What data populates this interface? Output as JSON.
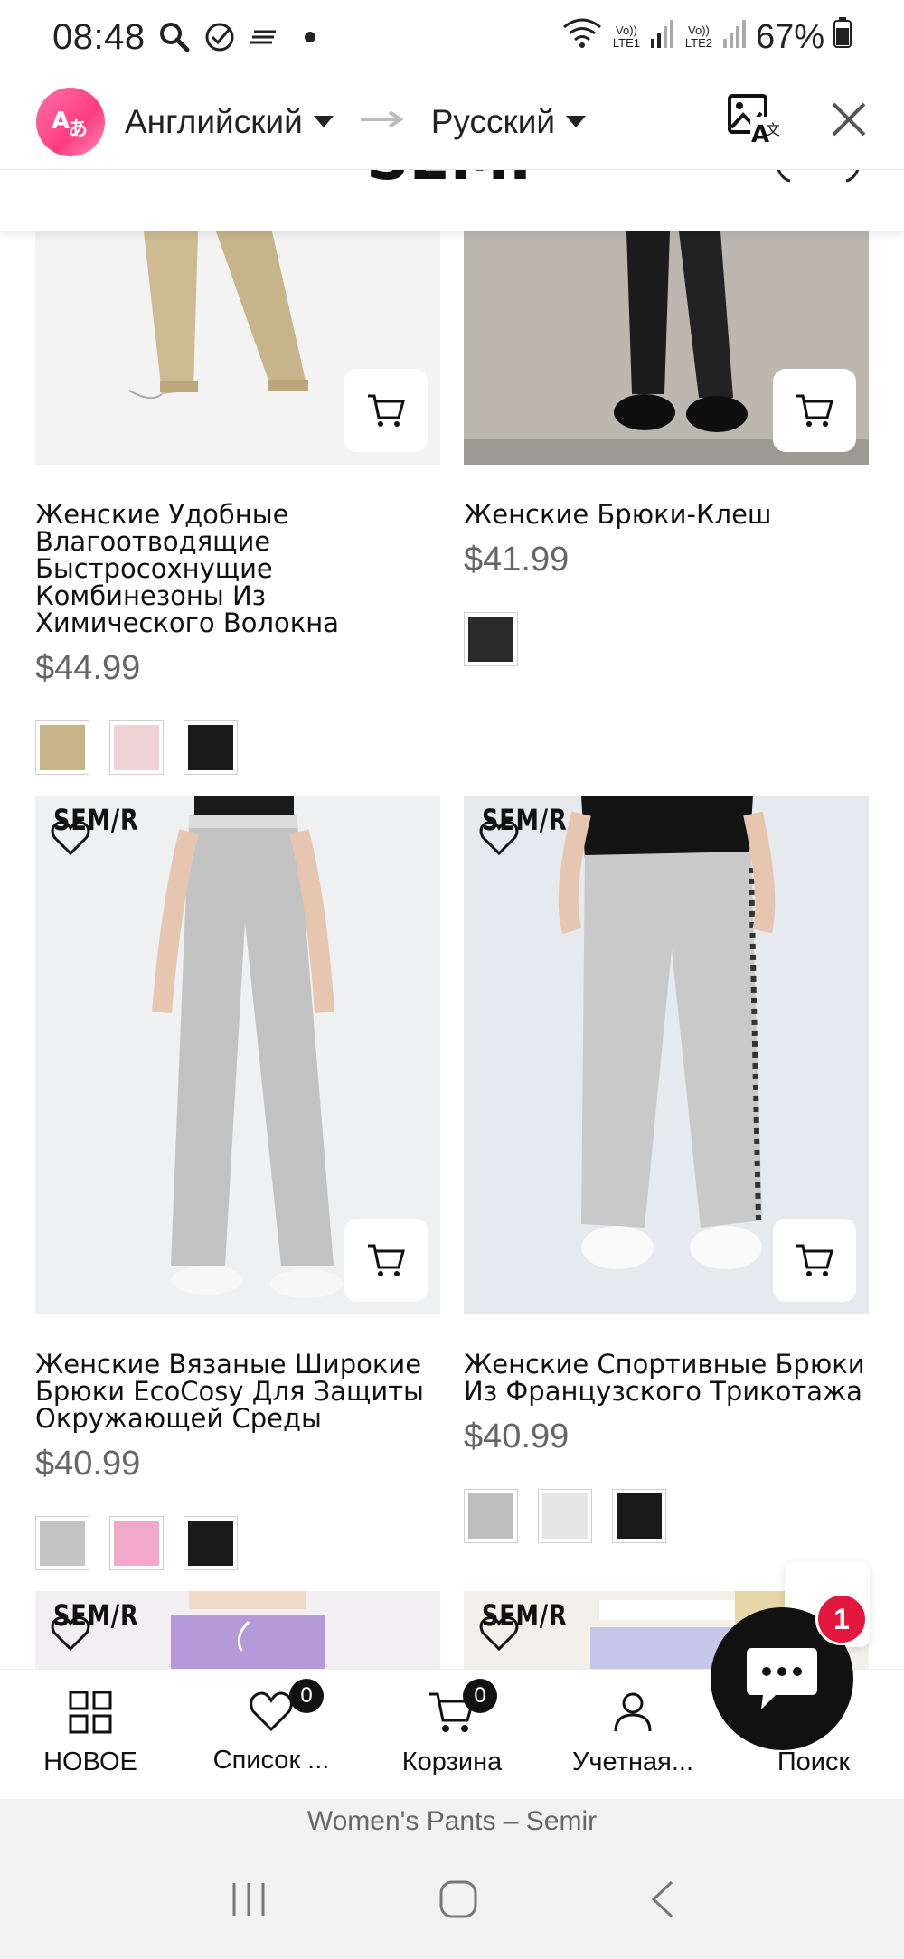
{
  "status_bar": {
    "time": "08:48",
    "lte1": "Vo)) LTE1",
    "lte2": "Vo)) LTE2",
    "battery": "67%"
  },
  "translate_bar": {
    "source_lang": "Английский",
    "target_lang": "Русский"
  },
  "products": [
    {
      "title": "Женские Удобные Влагоотводящие Быстросохнущие Комбинезоны Из Химического Волокна",
      "price": "$44.99",
      "swatches": [
        "#c9b48a",
        "#efd2d4",
        "#1a1a1a"
      ]
    },
    {
      "title": "Женские Брюки-Клеш",
      "price": "$41.99",
      "swatches": [
        "#2a2a2a"
      ]
    },
    {
      "brand": "SEM/R",
      "title": "Женские Вязаные Широкие Брюки EcoCosy Для Защиты Окружающей Среды",
      "price": "$40.99",
      "swatches": [
        "#c4c4c4",
        "#f2a9c9",
        "#1a1a1a"
      ]
    },
    {
      "brand": "SEM/R",
      "title": "Женские Спортивные Брюки Из Французского Трикотажа",
      "price": "$40.99",
      "swatches": [
        "#bdbdbd",
        "#e6e6e6",
        "#1a1a1a"
      ]
    },
    {
      "brand": "SEM/R"
    },
    {
      "brand": "SEM/R"
    }
  ],
  "bottom_nav": [
    {
      "label": "НОВОЕ",
      "icon": "grid-icon"
    },
    {
      "label": "Список ...",
      "icon": "heart-icon",
      "badge": "0"
    },
    {
      "label": "Корзина",
      "icon": "cart-icon",
      "badge": "0"
    },
    {
      "label": "Учетная...",
      "icon": "user-icon"
    },
    {
      "label": "Поиск",
      "icon": "search-icon"
    }
  ],
  "chat": {
    "badge": "1"
  },
  "page_title": "Women's Pants – Semir",
  "colors": {
    "accent_pink": "#ff3d7f",
    "badge_red": "#e3173e",
    "price_gray": "#666666"
  }
}
